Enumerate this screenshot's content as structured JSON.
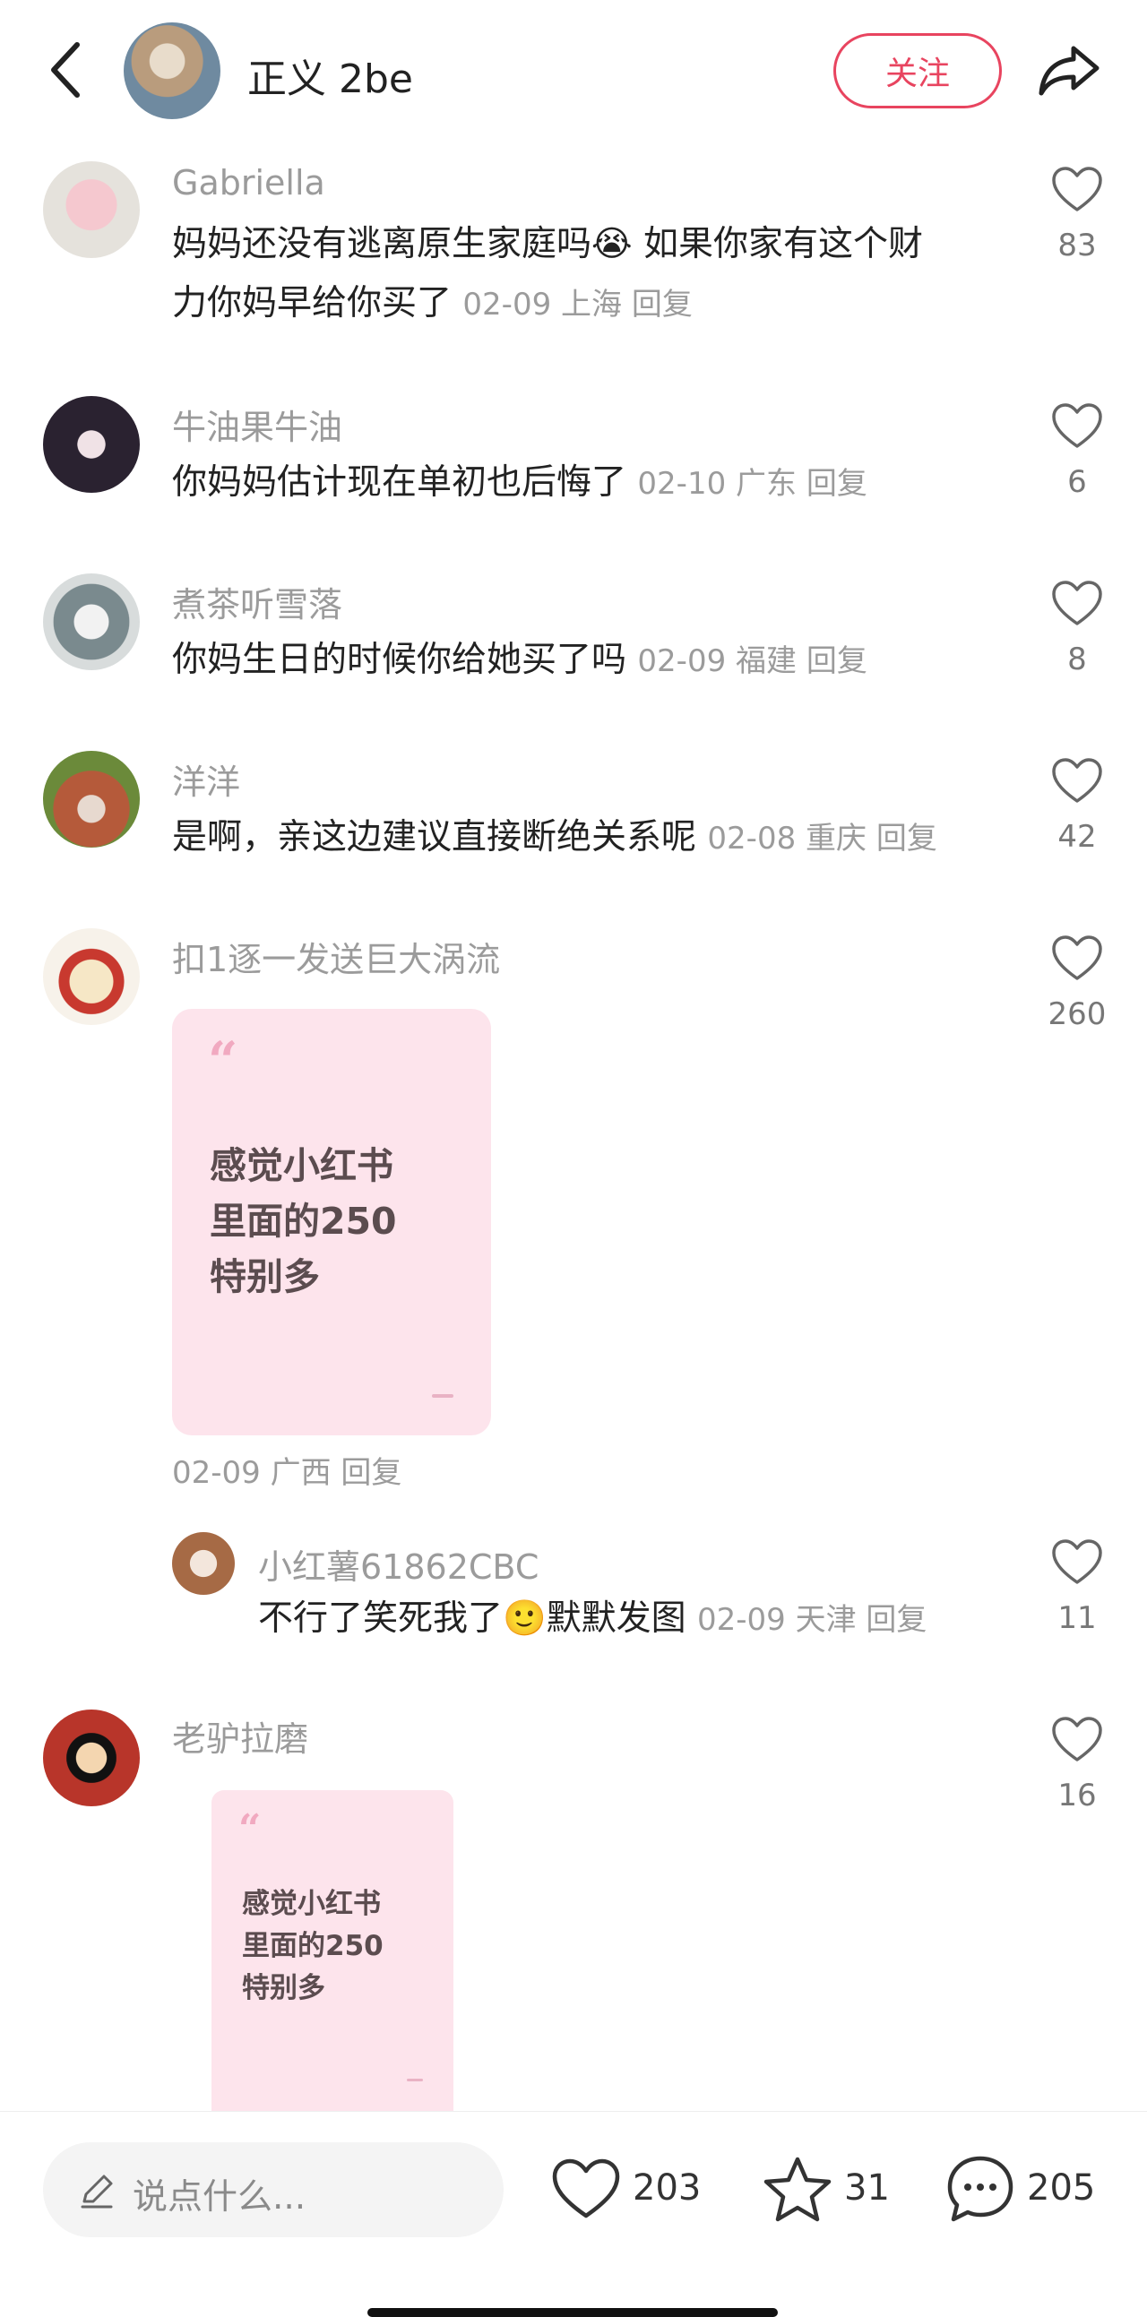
{
  "header": {
    "author_name": "正义 2be",
    "follow_label": "关注"
  },
  "comments": [
    {
      "name": "Gabriella",
      "text_1": "妈妈还没有逃离原生家庭吗",
      "emoji": "😭",
      "text_2": " 如果你家有这个财",
      "text_3": "力你妈早给你买了 ",
      "date": "02-09",
      "location": "上海",
      "reply": "回复",
      "likes": "83"
    },
    {
      "name": "牛油果牛油",
      "text": "你妈妈估计现在单初也后悔了 ",
      "date": "02-10",
      "location": "广东",
      "reply": "回复",
      "likes": "6"
    },
    {
      "name": "煮茶听雪落",
      "text": "你妈生日的时候你给她买了吗 ",
      "date": "02-09",
      "location": "福建",
      "reply": "回复",
      "likes": "8"
    },
    {
      "name": "洋洋",
      "text": "是啊，亲这边建议直接断绝关系呢 ",
      "date": "02-08",
      "location": "重庆",
      "reply": "回复",
      "likes": "42"
    },
    {
      "name": "扣1逐一发送巨大涡流",
      "card_text": [
        "感觉小红书",
        "里面的250",
        "特别多"
      ],
      "date": "02-09",
      "location": "广西",
      "reply": "回复",
      "likes": "260"
    },
    {
      "name": "小红薯61862CBC",
      "text": "不行了笑死我了",
      "emoji": "🙂",
      "text_after": "默默发图 ",
      "date": "02-09",
      "location": "天津",
      "reply": "回复",
      "likes": "11"
    },
    {
      "name": "老驴拉磨",
      "card_text": [
        "感觉小红书",
        "里面的250",
        "特别多"
      ],
      "likes": "16"
    }
  ],
  "bottom_bar": {
    "input_placeholder": "说点什么...",
    "like_count": "203",
    "star_count": "31",
    "comment_count": "205"
  },
  "colors": {
    "accent": "#e8445f",
    "card_bg": "#fde4ec"
  },
  "icons": [
    "back-icon",
    "share-icon",
    "heart-icon",
    "star-icon",
    "comment-icon",
    "pen-icon"
  ]
}
